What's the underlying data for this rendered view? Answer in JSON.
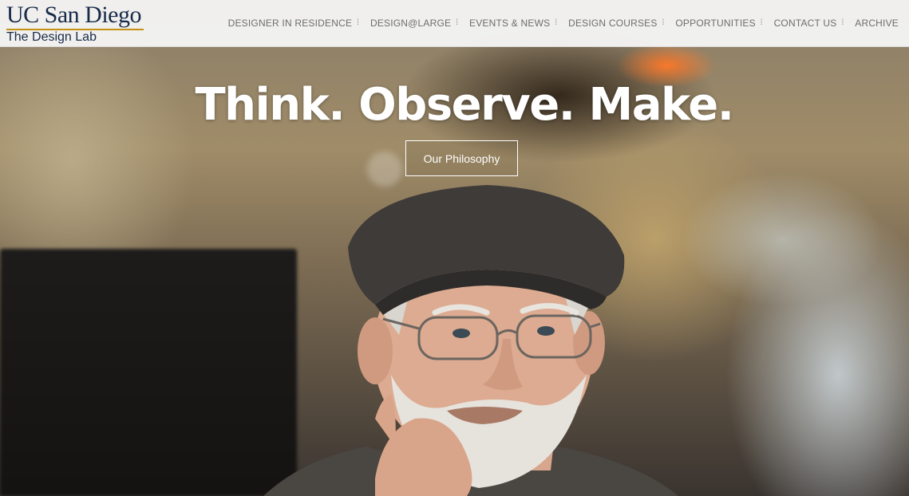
{
  "logo": {
    "main": "UC San Diego",
    "sub": "The Design Lab"
  },
  "nav": {
    "items": [
      {
        "label": "DESIGNER IN RESIDENCE"
      },
      {
        "label": "DESIGN@LARGE"
      },
      {
        "label": "EVENTS & NEWS"
      },
      {
        "label": "DESIGN COURSES"
      },
      {
        "label": "OPPORTUNITIES"
      },
      {
        "label": "CONTACT US"
      },
      {
        "label": "ARCHIVE"
      }
    ],
    "separator": "⁞"
  },
  "hero": {
    "headline": "Think. Observe. Make.",
    "cta_label": "Our Philosophy"
  },
  "colors": {
    "brand_navy": "#182b49",
    "brand_gold": "#c69214",
    "nav_text": "#6d6d6d"
  }
}
